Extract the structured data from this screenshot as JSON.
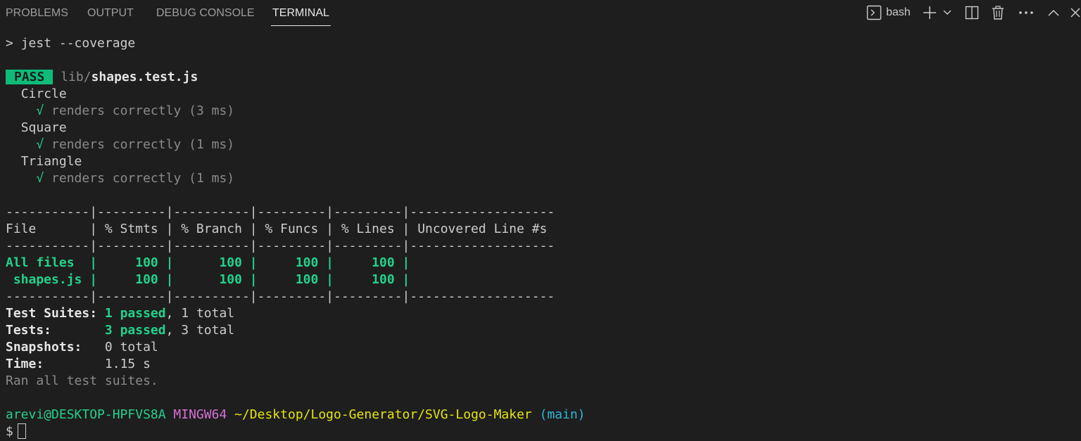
{
  "panel_tabs": [
    {
      "label": "PROBLEMS",
      "active": false
    },
    {
      "label": "OUTPUT",
      "active": false
    },
    {
      "label": "DEBUG CONSOLE",
      "active": false
    },
    {
      "label": "TERMINAL",
      "active": true
    }
  ],
  "toolbar": {
    "shell_name": "bash",
    "icons": [
      "terminal-icon",
      "plus-icon",
      "chevron-down-icon",
      "split-icon",
      "trash-icon",
      "ellipsis-icon",
      "chevron-up-icon",
      "close-icon"
    ]
  },
  "terminal": {
    "command_prompt": ">",
    "command": "jest --coverage",
    "pass_badge": "PASS",
    "test_file_dir": "lib/",
    "test_file_name": "shapes.test.js",
    "suites": [
      {
        "name": "Circle",
        "check": "√",
        "test": "renders correctly (3 ms)"
      },
      {
        "name": "Square",
        "check": "√",
        "test": "renders correctly (1 ms)"
      },
      {
        "name": "Triangle",
        "check": "√",
        "test": "renders correctly (1 ms)"
      }
    ],
    "coverage_table": {
      "separator": "-----------|---------|----------|---------|---------|-------------------",
      "header": "File       | % Stmts | % Branch | % Funcs | % Lines | Uncovered Line #s ",
      "rows": [
        {
          "label": "All files  ",
          "rest": "|     100 |      100 |     100 |     100 |                   "
        },
        {
          "label": " shapes.js ",
          "rest": "|     100 |      100 |     100 |     100 |                   "
        }
      ]
    },
    "summary": {
      "suites_label": "Test Suites: ",
      "suites_passed": "1 passed",
      "suites_total": ", 1 total",
      "tests_label": "Tests:       ",
      "tests_passed": "3 passed",
      "tests_total": ", 3 total",
      "snapshots_label": "Snapshots:   ",
      "snapshots_value": "0 total",
      "time_label": "Time:        ",
      "time_value": "1.15 s",
      "ran_all": "Ran all test suites."
    },
    "prompt": {
      "user_host": "arevi@DESKTOP-HPFVS8A",
      "system": "MINGW64",
      "path": "~/Desktop/Logo-Generator/SVG-Logo-Maker",
      "branch": "(main)",
      "symbol": "$"
    }
  },
  "colors": {
    "background": "#1e1e1e",
    "pass_badge": "#0dbc79",
    "green": "#23d18b",
    "yellow": "#e5e510",
    "magenta": "#d670d6",
    "cyan": "#29b8db"
  }
}
